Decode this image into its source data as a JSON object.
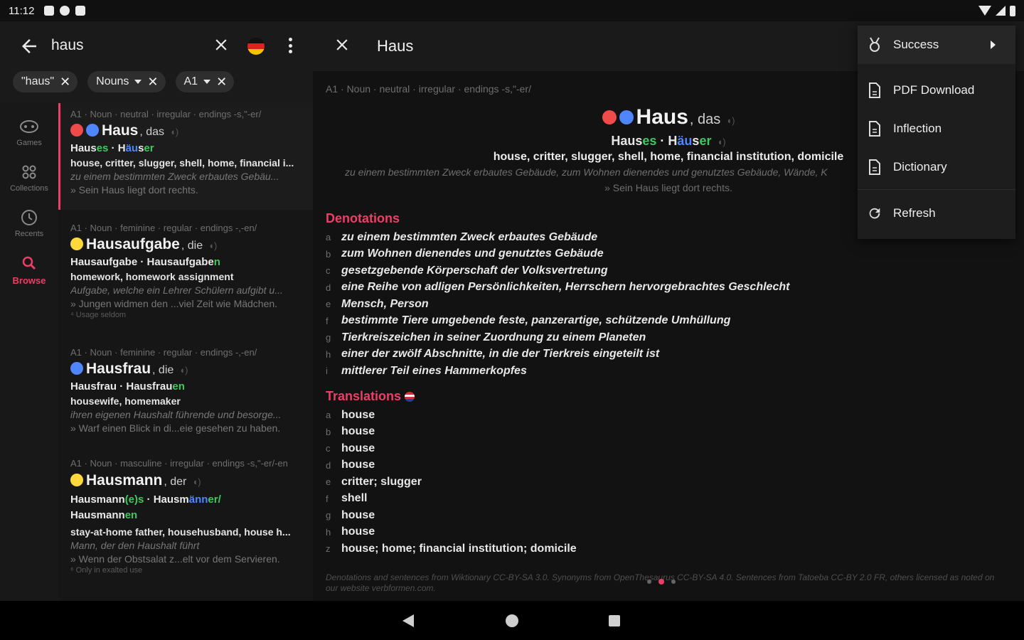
{
  "status": {
    "time": "11:12"
  },
  "search": {
    "query": "haus"
  },
  "filters": [
    {
      "label": "\"haus\""
    },
    {
      "label": "Nouns"
    },
    {
      "label": "A1"
    }
  ],
  "nav": [
    {
      "label": "Games",
      "icon": "games-icon"
    },
    {
      "label": "Collections",
      "icon": "collections-icon"
    },
    {
      "label": "Recents",
      "icon": "recents-icon"
    },
    {
      "label": "Browse",
      "icon": "search-icon"
    }
  ],
  "results": [
    {
      "meta": "A1 · Noun · neutral · irregular · endings -s,\"-er/",
      "word": "Haus",
      "article": ", das",
      "forms": {
        "a": "Haus",
        "a_end": "es",
        "sep": " · ",
        "b1": "H",
        "b_uml": "äu",
        "b2": "s",
        "b_end": "er"
      },
      "translation": "house, critter, slugger, shell, home, financial i...",
      "definition": "zu einem bestimmten Zweck erbautes Gebäu...",
      "example": "» Sein Haus liegt dort rechts."
    },
    {
      "meta": "A1 · Noun · feminine · regular · endings -,-en/",
      "word": "Hausaufgabe",
      "article": ", die",
      "forms": {
        "a": "Hausaufgabe",
        "sep": " · ",
        "b": "Hausaufgabe",
        "b_end": "n"
      },
      "translation": "homework, homework assignment",
      "definition": "Aufgabe, welche ein Lehrer Schülern aufgibt u...",
      "example": "» Jungen widmen den ...viel Zeit wie Mädchen.",
      "note": "⁴ Usage seldom"
    },
    {
      "meta": "A1 · Noun · feminine · regular · endings -,-en/",
      "word": "Hausfrau",
      "article": ", die",
      "forms": {
        "a": "Hausfrau",
        "sep": " · ",
        "b": "Hausfrau",
        "b_end": "en"
      },
      "translation": "housewife, homemaker",
      "definition": "ihren eigenen Haushalt führende und besorge...",
      "example": "» Warf einen Blick in di...eie gesehen zu haben."
    },
    {
      "meta": "A1 · Noun · masculine · irregular · endings -s,\"-er/-en",
      "word": "Hausmann",
      "article": ", der",
      "forms": {
        "a": "Hausmann",
        "a_end": "(e)s",
        "sep": " · ",
        "b1": "Hausm",
        "b_uml": "änn",
        "b_end": "er/",
        "c": "Hausmann",
        "c_end": "en"
      },
      "translation": "stay-at-home father, househusband, house h...",
      "definition": "Mann, der den Haushalt führt",
      "example": "» Wenn der Obstsalat z...elt vor dem Servieren.",
      "note": "⁶ Only in exalted use"
    }
  ],
  "detail": {
    "title": "Haus",
    "meta": "A1 · Noun · neutral · irregular · endings -s,\"-er/",
    "word": "Haus",
    "article": ", das",
    "forms": {
      "a": "Haus",
      "a_end": "es",
      "sep": " · ",
      "b1": "H",
      "b_uml": "äu",
      "b2": "s",
      "b_end": "er"
    },
    "translation": "house, critter, slugger, shell, home, financial institution, domicile",
    "definition": "zu einem bestimmten Zweck erbautes Gebäude, zum Wohnen dienendes und genutztes Gebäude, Wände, K",
    "example": "» Sein Haus liegt dort rechts.",
    "denotations_title": "Denotations",
    "denotations": [
      {
        "letter": "a",
        "text": "zu einem bestimmten Zweck erbautes Gebäude"
      },
      {
        "letter": "b",
        "text": "zum Wohnen dienendes und genutztes Gebäude"
      },
      {
        "letter": "c",
        "text": "gesetzgebende Körperschaft der Volksvertretung"
      },
      {
        "letter": "d",
        "text": "eine Reihe von adligen Persönlichkeiten, Herrschern hervorgebrachtes Geschlecht"
      },
      {
        "letter": "e",
        "text": "Mensch, Person"
      },
      {
        "letter": "f",
        "text": "bestimmte Tiere umgebende feste, panzerartige, schützende Umhüllung"
      },
      {
        "letter": "g",
        "text": "Tierkreiszeichen in seiner Zuordnung zu einem Planeten"
      },
      {
        "letter": "h",
        "text": "einer der zwölf Abschnitte, in die der Tierkreis eingeteilt ist"
      },
      {
        "letter": "i",
        "text": "mittlerer Teil eines Hammerkopfes"
      }
    ],
    "translations_title": "Translations",
    "translations": [
      {
        "letter": "a",
        "text": "house"
      },
      {
        "letter": "b",
        "text": "house"
      },
      {
        "letter": "c",
        "text": "house"
      },
      {
        "letter": "d",
        "text": "house"
      },
      {
        "letter": "e",
        "text": "critter; slugger"
      },
      {
        "letter": "f",
        "text": "shell"
      },
      {
        "letter": "g",
        "text": "house"
      },
      {
        "letter": "h",
        "text": "house"
      },
      {
        "letter": "z",
        "text": "house; home; financial institution; domicile"
      }
    ],
    "footer": "Denotations and sentences from Wiktionary CC-BY-SA 3.0. Synonyms from OpenThesaurus CC-BY-SA 4.0. Sentences from Tatoeba CC-BY 2.0 FR, others licensed as noted on our website verbformen.com."
  },
  "menu": [
    {
      "label": "Success",
      "icon": "medal-icon"
    },
    {
      "label": "PDF Download",
      "icon": "pdf-icon"
    },
    {
      "label": "Inflection",
      "icon": "document-icon"
    },
    {
      "label": "Dictionary",
      "icon": "document-icon"
    },
    {
      "label": "Refresh",
      "icon": "refresh-icon"
    }
  ],
  "colors": {
    "accent": "#ef3d68",
    "neutral_dot": "#4f86ff",
    "feminine_dot": "#ffd83b",
    "masc_dot": "#ffd83b",
    "red_dot": "#f04b4b",
    "green": "#3ec95c"
  }
}
